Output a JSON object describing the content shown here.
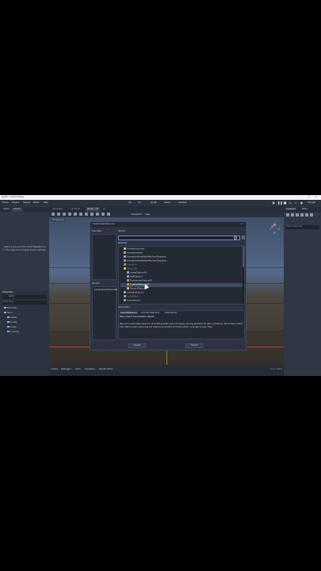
{
  "window": {
    "title": "godot – Godot Engine"
  },
  "menu": [
    "Scene",
    "Project",
    "Debug",
    "Editor",
    "Help"
  ],
  "workspaces": [
    "2D",
    "3D",
    "Script",
    "Game",
    "AssetLib"
  ],
  "renderer": "Compat",
  "left_dock": {
    "tabs": [
      "Scene",
      "Import"
    ],
    "hint": "Select a resource file in the filesystem or in the inspector to adjust import settings.",
    "filesystem": {
      "title": "FileSystem",
      "path": "res://",
      "filter_placeholder": "Filter Files",
      "items": [
        "Favorites:",
        "res://",
        "assets",
        "scripts",
        "levels",
        "icon.svg"
      ]
    }
  },
  "scene_tabs": [
    "[unsaved]",
    "world3D",
    "player_cha",
    "(*)"
  ],
  "viewport": {
    "perspective_label": "Perspective",
    "menu_items": [
      "Transform",
      "View"
    ]
  },
  "right_dock": {
    "tabs": [
      "Inspector",
      "Node"
    ],
    "filter_placeholder": "Filter Properties"
  },
  "dialog": {
    "title": "Create New Resource",
    "favorites_label": "Favorites:",
    "recent_label": "Recent:",
    "recent_items": [
      "CompressedTexture2D"
    ],
    "search_label": "Search:",
    "search_value": "",
    "matches_label": "Matches:",
    "classes": [
      {
        "name": "AnimationLibrary",
        "style": "normal"
      },
      {
        "name": "AnimationNode",
        "style": "normal"
      },
      {
        "name": "AnimationNodeStateMachinePlayback",
        "style": "normal"
      },
      {
        "name": "AnimationNodeStateMachineTransition",
        "style": "normal"
      },
      {
        "name": "Animation",
        "style": "dim"
      },
      {
        "name": "Texture2D",
        "style": "dim"
      },
      {
        "name": "ImageTexture3D",
        "style": "normal"
      },
      {
        "name": "AtlasTexture",
        "style": "normal"
      },
      {
        "name": "PlaceholderTexture2D",
        "style": "normal"
      },
      {
        "name": "GradientTexture2D",
        "style": "selected"
      },
      {
        "name": "CameraTexture",
        "style": "normal"
      },
      {
        "name": "AudioBusLayout",
        "style": "normal"
      },
      {
        "name": "AudioEffect",
        "style": "dim"
      },
      {
        "name": "AudioStream",
        "style": "normal"
      }
    ],
    "description_label": "Description:",
    "desc_tabs": [
      "Class Reference",
      "Inherits: Resource",
      "Inherited by"
    ],
    "brief": "Base class for serializable objects.",
    "description": "Resource is the base class for all Godot-specific resource types, serving primarily as data containers. Since they inherit from RefCounted, resources are reference-counted and freed when no longer in use. They",
    "create_label": "Create",
    "cancel_label": "Cancel"
  },
  "bottom_panel": [
    "Output",
    "Debugger",
    "Audio",
    "Animation",
    "Shader Editor"
  ],
  "version": "4.2.1.stable",
  "colors": {
    "accent": "#5f8fd6",
    "editor_bg": "#262c38",
    "axis_red": "#d94a4a",
    "axis_green": "#7fbf3f"
  }
}
